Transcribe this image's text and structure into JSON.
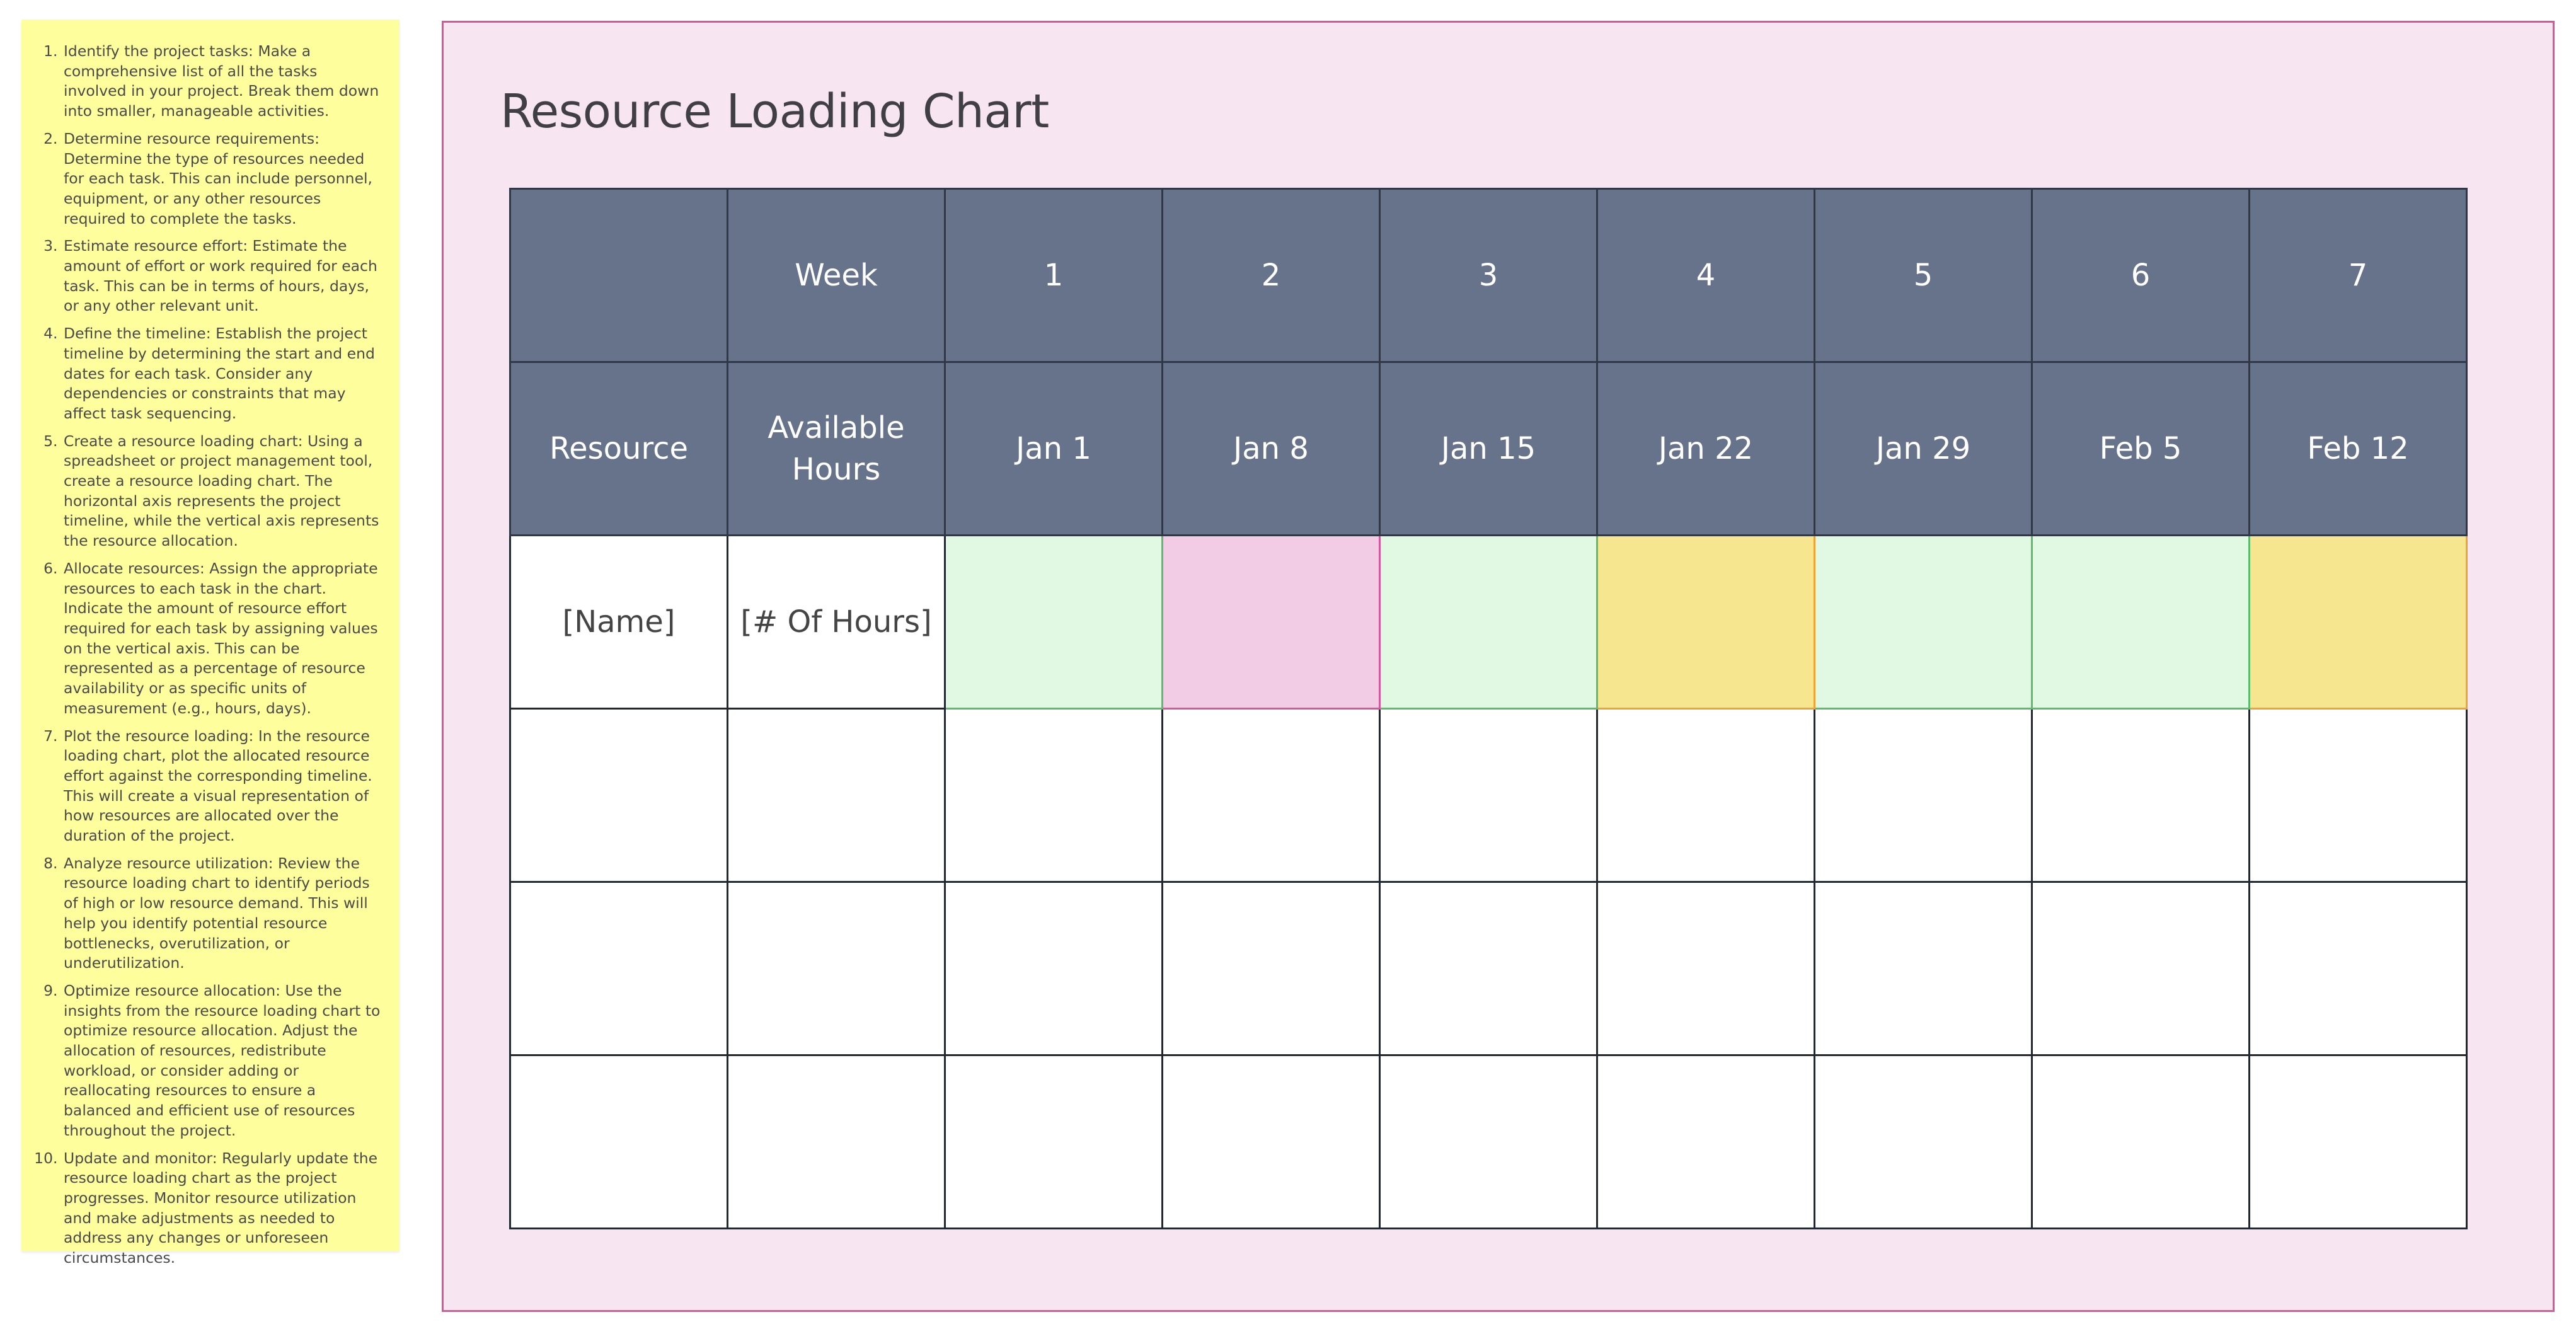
{
  "sticky_note": {
    "steps": [
      "Identify the project tasks: Make a comprehensive list of all the tasks involved in your project. Break them down into smaller, manageable activities.",
      "Determine resource requirements: Determine the type of resources needed for each task. This can include personnel, equipment, or any other resources required to complete the tasks.",
      "Estimate resource effort: Estimate the amount of effort or work required for each task. This can be in terms of hours, days, or any other relevant unit.",
      "Define the timeline: Establish the project timeline by determining the start and end dates for each task. Consider any dependencies or constraints that may affect task sequencing.",
      "Create a resource loading chart: Using a spreadsheet or project management tool, create a resource loading chart. The horizontal axis represents the project timeline, while the vertical axis represents the resource allocation.",
      "Allocate resources: Assign the appropriate resources to each task in the chart. Indicate the amount of resource effort required for each task by assigning values on the vertical axis. This can be represented as a percentage of resource availability or as specific units of measurement (e.g., hours, days).",
      "Plot the resource loading: In the resource loading chart, plot the allocated resource effort against the corresponding timeline. This will create a visual representation of how resources are allocated over the duration of the project.",
      "Analyze resource utilization: Review the resource loading chart to identify periods of high or low resource demand. This will help you identify potential resource bottlenecks, overutilization, or underutilization.",
      "Optimize resource allocation: Use the insights from the resource loading chart to optimize resource allocation. Adjust the allocation of resources, redistribute workload, or consider adding or reallocating resources to ensure a balanced and efficient use of resources throughout the project.",
      "Update and monitor: Regularly update the resource loading chart as the project progresses. Monitor resource utilization and make adjustments as needed to address any changes or unforeseen circumstances."
    ]
  },
  "frame": {
    "title": "Resource Loading Chart"
  },
  "table": {
    "week_label": "Week",
    "week_numbers": [
      "1",
      "2",
      "3",
      "4",
      "5",
      "6",
      "7"
    ],
    "resource_label": "Resource",
    "hours_label": "Available Hours",
    "dates": [
      "Jan 1",
      "Jan 8",
      "Jan 15",
      "Jan 22",
      "Jan 29",
      "Feb 5",
      "Feb 12"
    ],
    "row1": {
      "name": "[Name]",
      "hours": "[# Of Hours]",
      "cell_status": [
        "green",
        "pink",
        "green",
        "yellow",
        "green",
        "green",
        "yellow"
      ]
    }
  },
  "colors": {
    "header_bg": "#66738a",
    "frame_bg": "#f7e6f2",
    "frame_border": "#d9569f",
    "sticky_bg": "#fefe9c",
    "green": "#e1f8e2",
    "pink": "#f2cbe4",
    "yellow": "#f7e690"
  }
}
